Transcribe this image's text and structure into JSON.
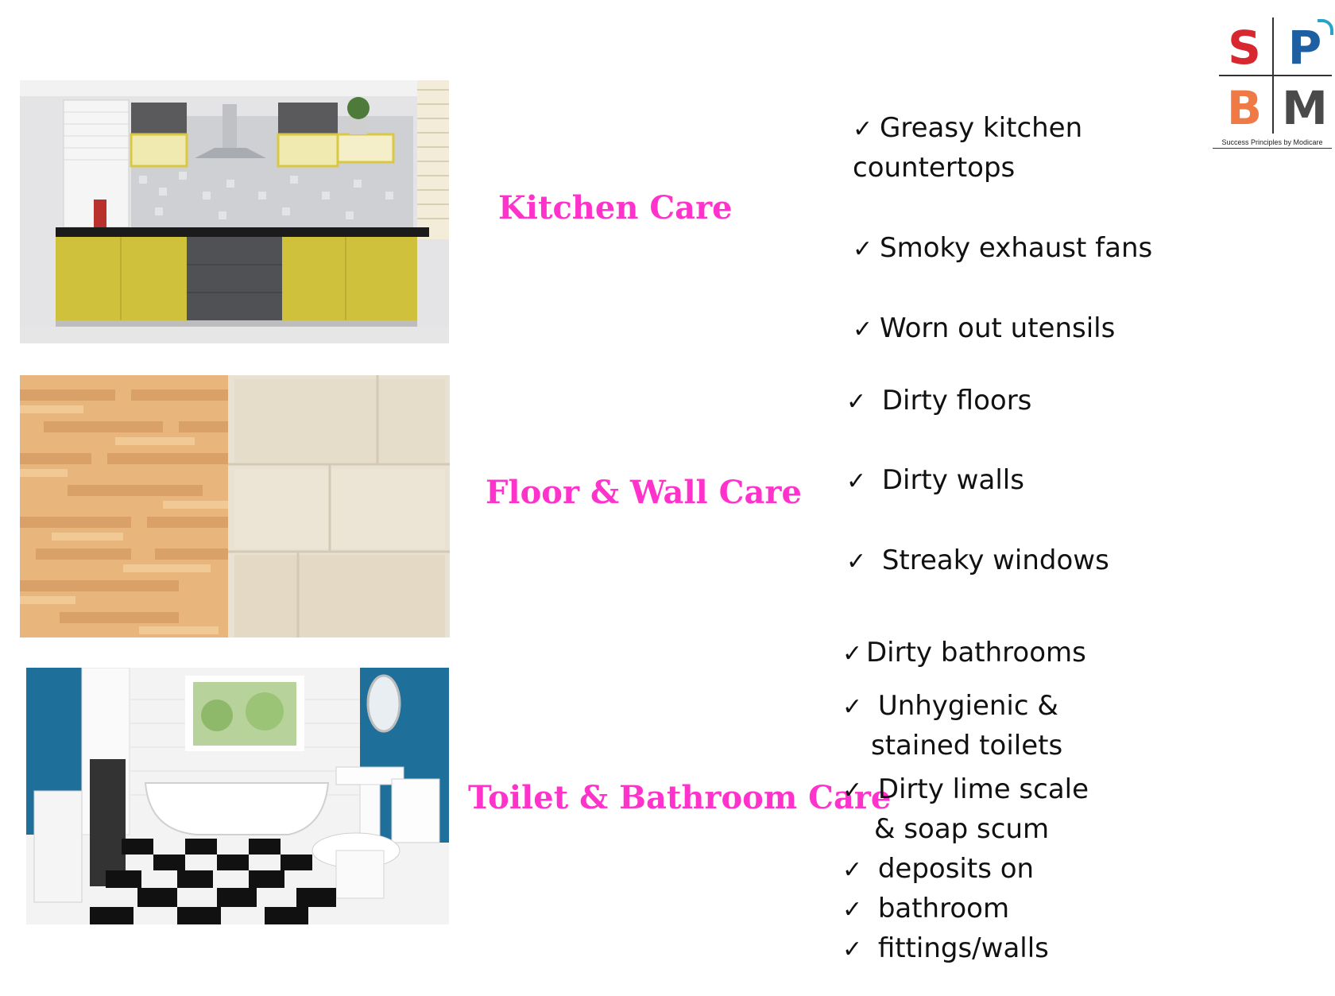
{
  "logo": {
    "letters": [
      "S",
      "P",
      "B",
      "M"
    ],
    "tagline": "Success Principles by Modicare",
    "colors": {
      "s": "#d7272f",
      "p": "#1d5fa0",
      "b": "#ef7a45",
      "m": "#4a4a4a"
    }
  },
  "accent_color": "#ff33cc",
  "check_symbol": "✓",
  "sections": [
    {
      "title": "Kitchen Care",
      "image_icon": "kitchen-photo",
      "items": [
        {
          "lines": [
            "Greasy kitchen",
            "countertops"
          ]
        },
        {
          "lines": [
            "Smoky exhaust fans"
          ]
        },
        {
          "lines": [
            "Worn out utensils"
          ]
        }
      ]
    },
    {
      "title": "Floor & Wall Care",
      "image_icon": "floor-wall-tiles-photo",
      "items": [
        {
          "lines": [
            "Dirty floors"
          ]
        },
        {
          "lines": [
            "Dirty walls"
          ]
        },
        {
          "lines": [
            "Streaky windows"
          ]
        }
      ]
    },
    {
      "title": "Toilet & Bathroom Care",
      "image_icon": "bathroom-photo",
      "items": [
        {
          "lines": [
            "Dirty bathrooms"
          ]
        },
        {
          "lines": [
            "Unhygienic &",
            "stained toilets"
          ]
        },
        {
          "lines": [
            "Dirty lime scale",
            "& soap scum"
          ]
        },
        {
          "lines": [
            "deposits on"
          ]
        },
        {
          "lines": [
            "bathroom"
          ]
        },
        {
          "lines": [
            "fittings/walls"
          ]
        }
      ]
    }
  ]
}
